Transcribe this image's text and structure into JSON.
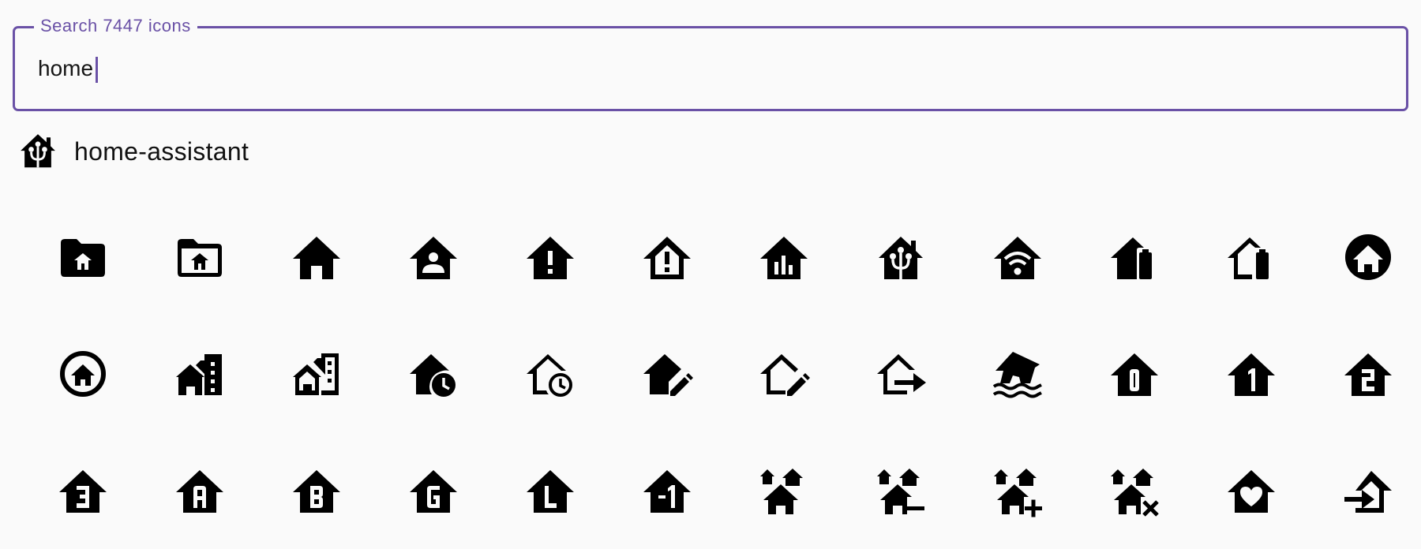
{
  "search": {
    "label": "Search 7447 icons",
    "value": "home"
  },
  "featured": {
    "icon": "home-assistant-icon",
    "label": "home-assistant"
  },
  "icons": [
    "folder-home-icon",
    "folder-home-outline-icon",
    "home-icon",
    "home-account-icon",
    "home-alert-icon",
    "home-alert-outline-icon",
    "home-analytics-icon",
    "home-assistant-icon",
    "home-automation-icon",
    "home-battery-icon",
    "home-battery-outline-icon",
    "home-circle-icon",
    "home-circle-outline-icon",
    "home-city-icon",
    "home-city-outline-icon",
    "home-clock-icon",
    "home-clock-outline-icon",
    "home-edit-icon",
    "home-edit-outline-icon",
    "home-export-outline-icon",
    "home-flood-icon",
    "home-floor-0-icon",
    "home-floor-1-icon",
    "home-floor-2-icon",
    "home-floor-3-icon",
    "home-floor-a-icon",
    "home-floor-b-icon",
    "home-floor-g-icon",
    "home-floor-l-icon",
    "home-floor-negative-1-icon",
    "home-group-icon",
    "home-group-minus-icon",
    "home-group-plus-icon",
    "home-group-remove-icon",
    "home-heart-icon",
    "home-import-outline-icon"
  ]
}
